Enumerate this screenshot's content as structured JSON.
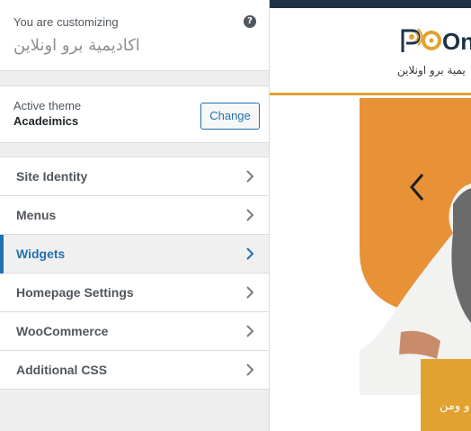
{
  "customizer": {
    "customizing_label": "You are customizing",
    "site_name": "اكاديمية برو اونلاين",
    "help_icon": "question-circle-icon"
  },
  "theme": {
    "label": "Active theme",
    "name": "Acadeimics",
    "change_label": "Change"
  },
  "panels": [
    {
      "label": "Site Identity",
      "icon": "chevron-right-icon",
      "active": false
    },
    {
      "label": "Menus",
      "icon": "chevron-right-icon",
      "active": false
    },
    {
      "label": "Widgets",
      "icon": "chevron-right-icon",
      "active": true
    },
    {
      "label": "Homepage Settings",
      "icon": "chevron-right-icon",
      "active": false
    },
    {
      "label": "WooCommerce",
      "icon": "chevron-right-icon",
      "active": false
    },
    {
      "label": "Additional CSS",
      "icon": "chevron-right-icon",
      "active": false
    }
  ],
  "preview": {
    "logo_text": "Onli",
    "tagline": "يمية برو اونلاين",
    "hero_card_text": "و ومن",
    "slider_prev_icon": "chevron-left-icon"
  },
  "colors": {
    "accent": "#2271b1",
    "hero_orange": "#e89237",
    "header_border": "#e2a230",
    "topbar": "#1e3146"
  }
}
